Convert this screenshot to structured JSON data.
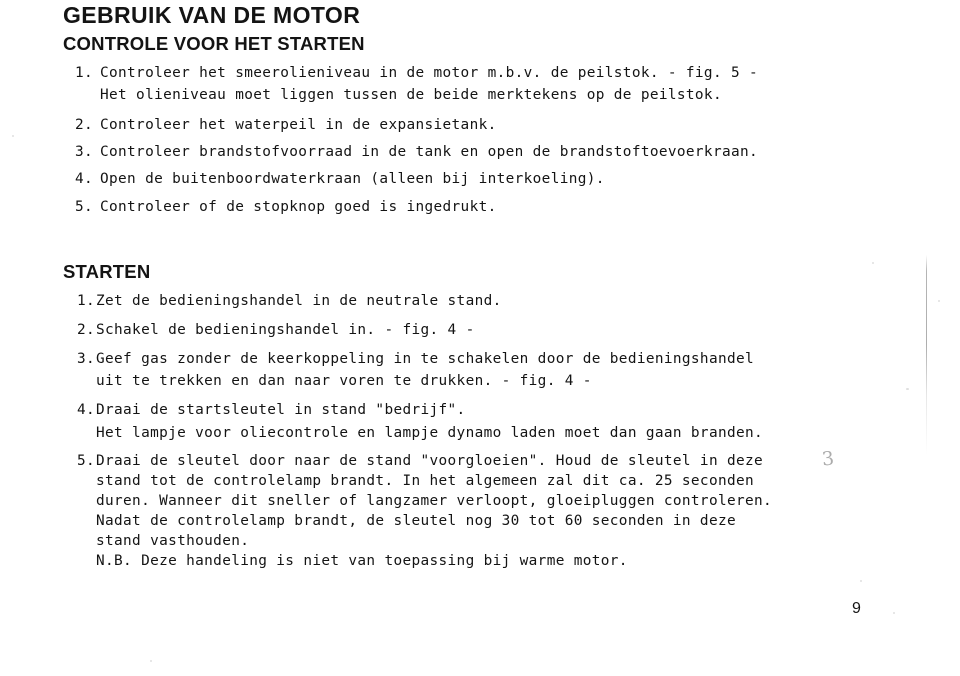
{
  "document": {
    "heading_main": "GEBRUIK VAN DE MOTOR",
    "heading_sub": "CONTROLE VOOR HET STARTEN",
    "section_heading": "STARTEN",
    "page_number": "9",
    "margin_mark": "3"
  },
  "checklist": {
    "items": [
      {
        "number": "1.",
        "lines": [
          "Controleer het smeerolieniveau in de motor m.b.v. de peilstok. - fig. 5 -",
          "Het olieniveau moet liggen tussen de beide merktekens op de peilstok."
        ]
      },
      {
        "number": "2.",
        "lines": [
          "Controleer het waterpeil in de expansietank."
        ]
      },
      {
        "number": "3.",
        "lines": [
          "Controleer brandstofvoorraad in de tank en open de brandstoftoevoerkraan."
        ]
      },
      {
        "number": "4.",
        "lines": [
          "Open de buitenboordwaterkraan (alleen bij interkoeling)."
        ]
      },
      {
        "number": "5.",
        "lines": [
          "Controleer of de stopknop goed is ingedrukt."
        ]
      }
    ]
  },
  "starting": {
    "items": [
      {
        "number": "1.",
        "lines": [
          "Zet de bedieningshandel in de neutrale stand."
        ]
      },
      {
        "number": "2.",
        "lines": [
          "Schakel de bedieningshandel in. - fig. 4 -"
        ]
      },
      {
        "number": "3.",
        "lines": [
          "Geef gas zonder de keerkoppeling in te schakelen door de bedieningshandel",
          "uit te trekken en dan naar voren te drukken. - fig. 4 -"
        ]
      },
      {
        "number": "4.",
        "lines": [
          "Draai de startsleutel in stand \"bedrijf\".",
          "Het lampje voor oliecontrole en lampje dynamo laden moet dan gaan branden."
        ]
      },
      {
        "number": "5.",
        "lines": [
          "Draai de sleutel door naar de stand \"voorgloeien\". Houd de sleutel in deze",
          "stand tot de controlelamp brandt. In het algemeen zal dit ca. 25 seconden",
          "duren. Wanneer dit sneller of langzamer verloopt, gloeipluggen controleren.",
          "Nadat de controlelamp brandt, de sleutel nog 30 tot 60 seconden in deze",
          "stand vasthouden.",
          "N.B. Deze handeling is niet van toepassing bij warme motor."
        ]
      }
    ]
  }
}
